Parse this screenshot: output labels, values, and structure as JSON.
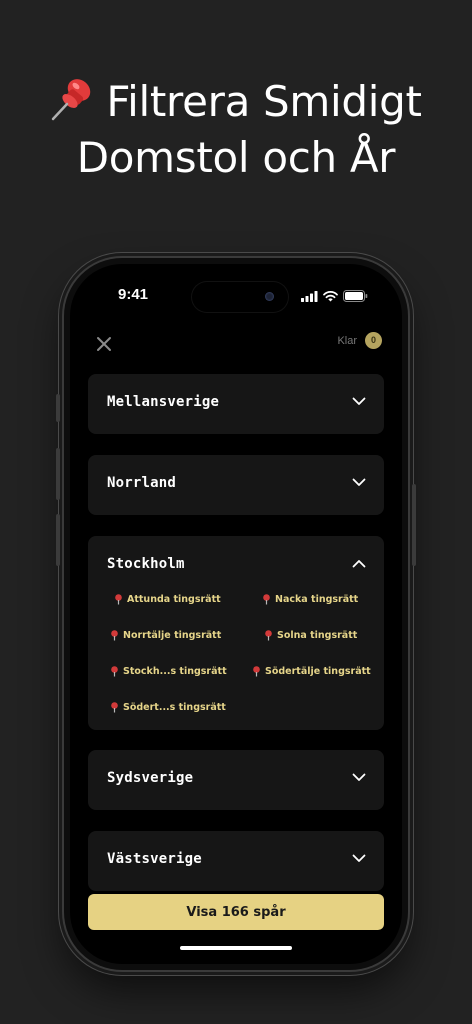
{
  "headline": {
    "line1": "Filtrera Smidigt",
    "line2": "Domstol och År",
    "icon": "pushpin-icon"
  },
  "status_bar": {
    "time": "9:41"
  },
  "header": {
    "close_icon": "close-icon",
    "done_label": "Klar",
    "selected_count": "0"
  },
  "regions": [
    {
      "name": "Mellansverige",
      "expanded": false
    },
    {
      "name": "Norrland",
      "expanded": false
    },
    {
      "name": "Stockholm",
      "expanded": true,
      "courts": [
        "Attunda tingsrätt",
        "Nacka tingsrätt",
        "Norrtälje tingsrätt",
        "Solna tingsrätt",
        "Stockh...s tingsrätt",
        "Södertälje tingsrätt",
        "Södert...s tingsrätt"
      ]
    },
    {
      "name": "Sydsverige",
      "expanded": false
    },
    {
      "name": "Västsverige",
      "expanded": false
    }
  ],
  "cta": {
    "label": "Visa 166 spår"
  },
  "colors": {
    "background": "#222222",
    "accent": "#e6d283",
    "court_text": "#e6d58a",
    "pin": "#d23a3a",
    "card": "#161616"
  }
}
